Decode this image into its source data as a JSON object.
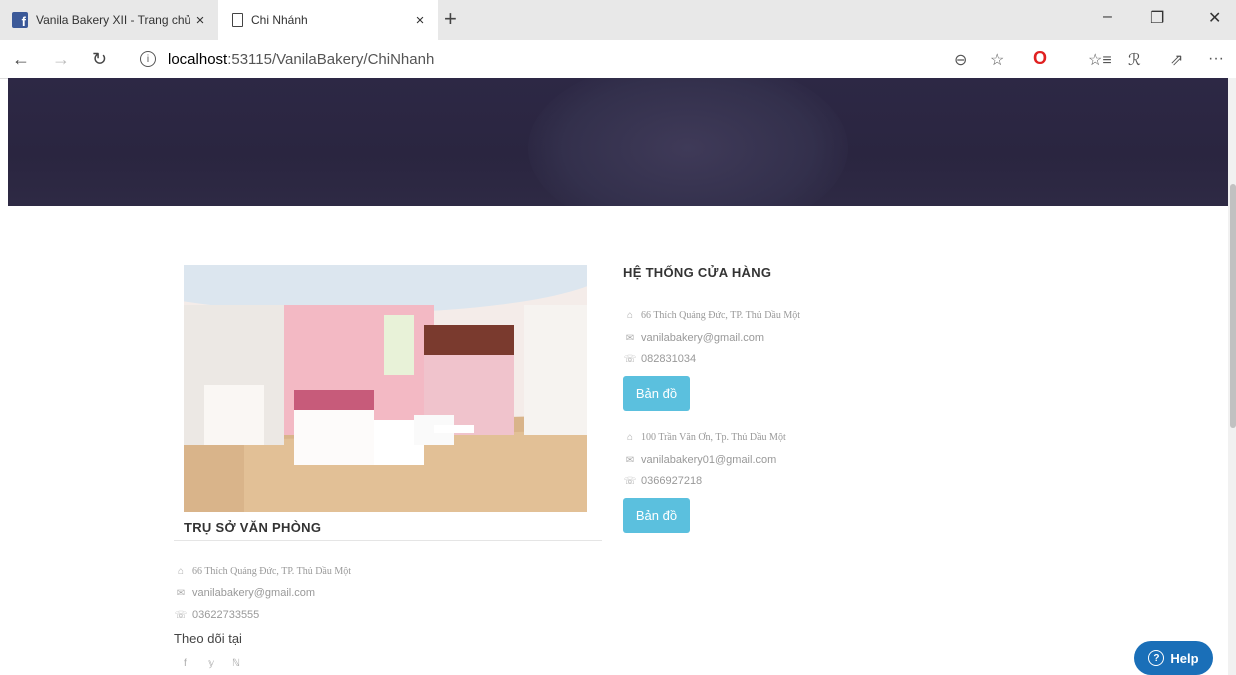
{
  "browser": {
    "tabs": [
      {
        "label": "Vanila Bakery XII - Trang chủ",
        "icon": "facebook-icon",
        "close": "×"
      },
      {
        "label": "Chi Nhánh",
        "icon": "page-icon",
        "close": "×"
      }
    ],
    "new_tab": "+",
    "window_controls": {
      "minimize": "–",
      "restore": "❐",
      "close": "✕"
    },
    "url_host": "localhost",
    "url_rest": ":53115/VanilaBakery/ChiNhanh",
    "nav": {
      "back": "←",
      "forward": "→",
      "refresh": "↻"
    },
    "toolbar_icons": {
      "zoom": "⊖",
      "favorite": "☆",
      "opera": "O",
      "favorites_bar": "☆≡",
      "profile": "ℛ",
      "share": "⇗",
      "more": "···"
    }
  },
  "main": {
    "photo_alt": "store interior",
    "office": {
      "title": "TRỤ SỞ VĂN PHÒNG",
      "address": "66 Thích Quảng Đức, TP. Thủ Dầu Một",
      "email": "vanilabakery@gmail.com",
      "phone": "03622733555",
      "follow_label": "Theo dõi tại",
      "social": [
        "f",
        "𝕪",
        "ℕ"
      ]
    },
    "stores": {
      "title": "HỆ THỐNG CỬA HÀNG",
      "list": [
        {
          "address": "66 Thích Quảng Đức, TP. Thủ Dầu Một",
          "email": "vanilabakery@gmail.com",
          "phone": "082831034",
          "button": "Bản đồ"
        },
        {
          "address": "100 Trần Văn Ơn, Tp. Thủ Dầu Một",
          "email": "vanilabakery01@gmail.com",
          "phone": "0366927218",
          "button": "Bản đồ"
        }
      ]
    }
  },
  "help": {
    "label": "Help",
    "icon": "?"
  },
  "colors": {
    "accent_button": "#5bc0de",
    "hero": "#2d2845",
    "help": "#1a6fb8"
  }
}
